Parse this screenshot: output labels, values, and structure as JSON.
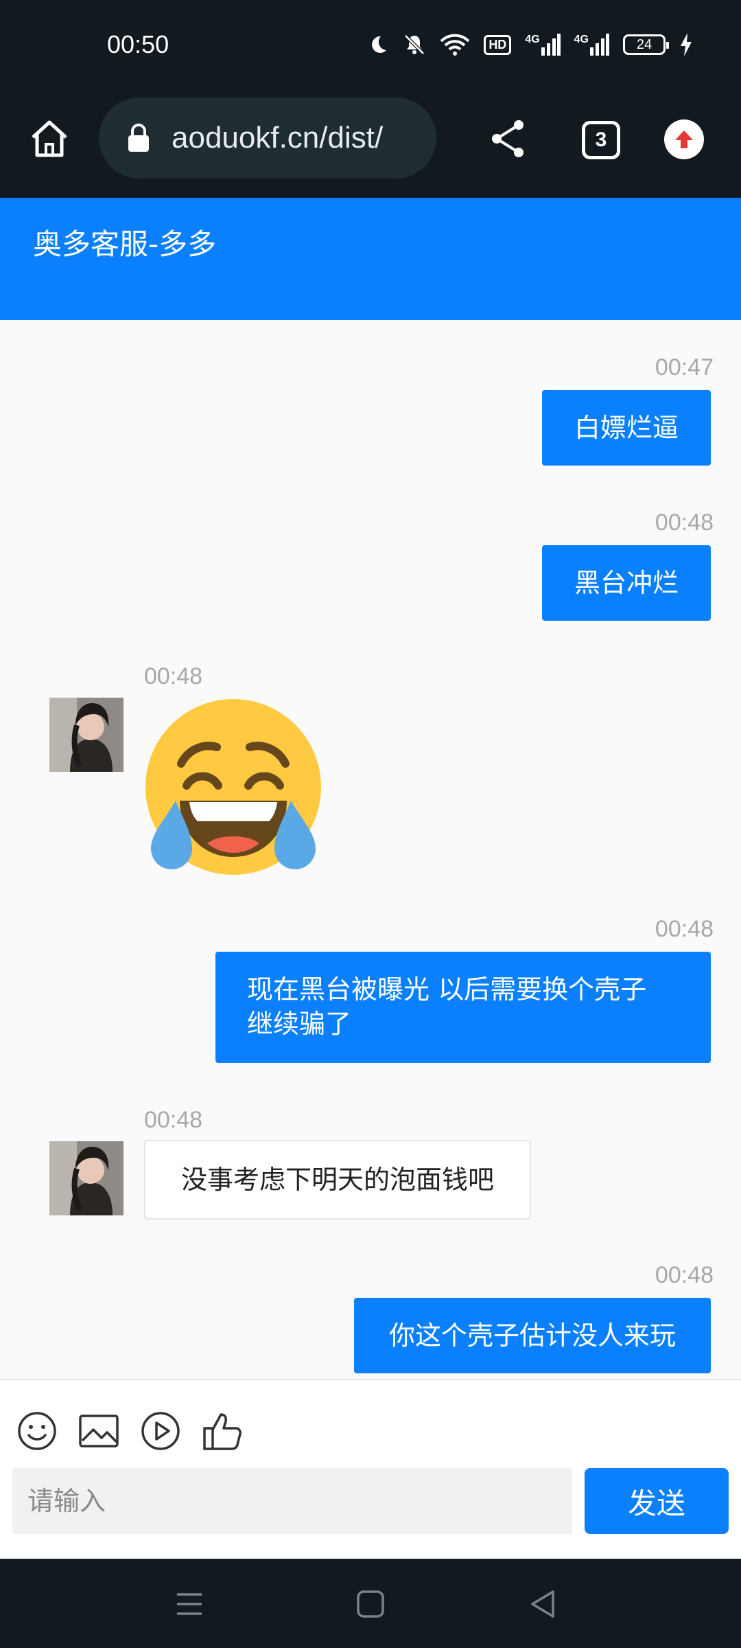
{
  "status_bar": {
    "time": "00:50",
    "network_badge": "HD",
    "network_type_1": "4G",
    "network_type_2": "4G",
    "battery": "24",
    "icons": [
      "moon-icon",
      "bell-off-icon",
      "wifi-icon",
      "hd-icon",
      "signal-icon",
      "signal-icon",
      "battery-icon",
      "charging-icon"
    ]
  },
  "browser": {
    "url": "aoduokf.cn/dist/",
    "tab_count": "3",
    "icons": [
      "home-icon",
      "lock-icon",
      "share-icon",
      "tabs-icon",
      "upgrade-icon"
    ]
  },
  "header": {
    "title": "奥多客服-多多"
  },
  "messages": [
    {
      "direction": "out",
      "time": "00:47",
      "text": "白嫖烂逼"
    },
    {
      "direction": "out",
      "time": "00:48",
      "text": "黑台冲烂"
    },
    {
      "direction": "in",
      "time": "00:48",
      "type": "emoji",
      "emoji": "tears-of-joy"
    },
    {
      "direction": "out",
      "time": "00:48",
      "lines": [
        "现在黑台被曝光 以后需要换个壳子",
        "继续骗了"
      ]
    },
    {
      "direction": "in",
      "time": "00:48",
      "text": "没事考虑下明天的泡面钱吧"
    },
    {
      "direction": "out",
      "time": "00:48",
      "text": "你这个壳子估计没人来玩"
    }
  ],
  "composer": {
    "placeholder": "请输入",
    "send_label": "发送",
    "tools": [
      "emoji-icon",
      "image-icon",
      "video-icon",
      "thumbs-up-icon"
    ]
  },
  "nav": {
    "icons": [
      "menu-icon",
      "home-square-icon",
      "back-icon"
    ]
  },
  "colors": {
    "brand": "#0a80ff",
    "dark": "#121a20"
  }
}
